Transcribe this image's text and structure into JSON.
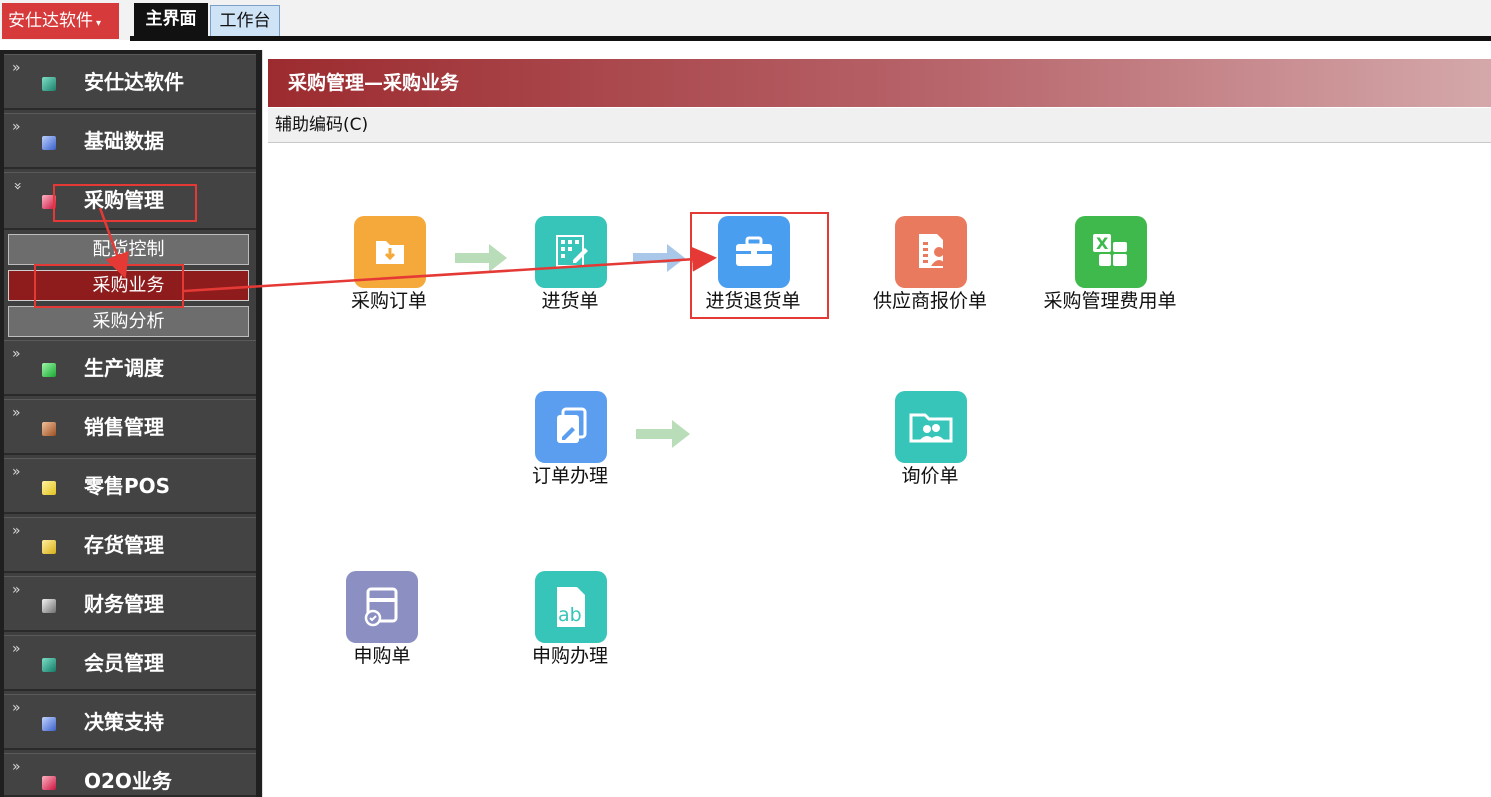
{
  "topbar": {
    "app_menu": "安仕达软件",
    "tabs": [
      "主界面",
      "工作台"
    ]
  },
  "sidebar": {
    "items": [
      {
        "label": "安仕达软件",
        "icon": "app-icon",
        "color": "#2aa58a"
      },
      {
        "label": "基础数据",
        "icon": "database-icon",
        "color": "#4a74d6"
      },
      {
        "label": "采购管理",
        "icon": "purchase-icon",
        "color": "#e0315b"
      },
      {
        "label": "生产调度",
        "icon": "production-icon",
        "color": "#2fc24a"
      },
      {
        "label": "销售管理",
        "icon": "sales-icon",
        "color": "#c87a44"
      },
      {
        "label": "零售POS",
        "icon": "pos-icon",
        "color": "#f0d23a"
      },
      {
        "label": "存货管理",
        "icon": "inventory-icon",
        "color": "#e8c63a"
      },
      {
        "label": "财务管理",
        "icon": "finance-icon",
        "color": "#9a9a9a"
      },
      {
        "label": "会员管理",
        "icon": "member-icon",
        "color": "#26a38e"
      },
      {
        "label": "决策支持",
        "icon": "decision-icon",
        "color": "#4a78d6"
      },
      {
        "label": "O2O业务",
        "icon": "o2o-icon",
        "color": "#e0315b"
      }
    ],
    "purchase_sub": [
      "配货控制",
      "采购业务",
      "采购分析"
    ]
  },
  "header": {
    "title": "采购管理—采购业务",
    "subbar": "辅助编码(C)"
  },
  "icons": {
    "purchase_order": {
      "label": "采购订单",
      "color": "#f6a93b"
    },
    "receipt": {
      "label": "进货单",
      "color": "#36c5b8"
    },
    "return": {
      "label": "进货退货单",
      "color": "#4a9ef0"
    },
    "supplier_quote": {
      "label": "供应商报价单",
      "color": "#ea7a5e"
    },
    "fee": {
      "label": "采购管理费用单",
      "color": "#3fb84c"
    },
    "order_process": {
      "label": "订单办理",
      "color": "#5b9ef0"
    },
    "inquiry": {
      "label": "询价单",
      "color": "#36c5b8"
    },
    "requisition": {
      "label": "申购单",
      "color": "#8c8fc2"
    },
    "requisition_process": {
      "label": "申购办理",
      "color": "#36c5b8"
    }
  },
  "colors": {
    "highlight": "#e53935",
    "flow_arrow": "#b9dcb9",
    "active_sub": "#8e1c1c"
  }
}
